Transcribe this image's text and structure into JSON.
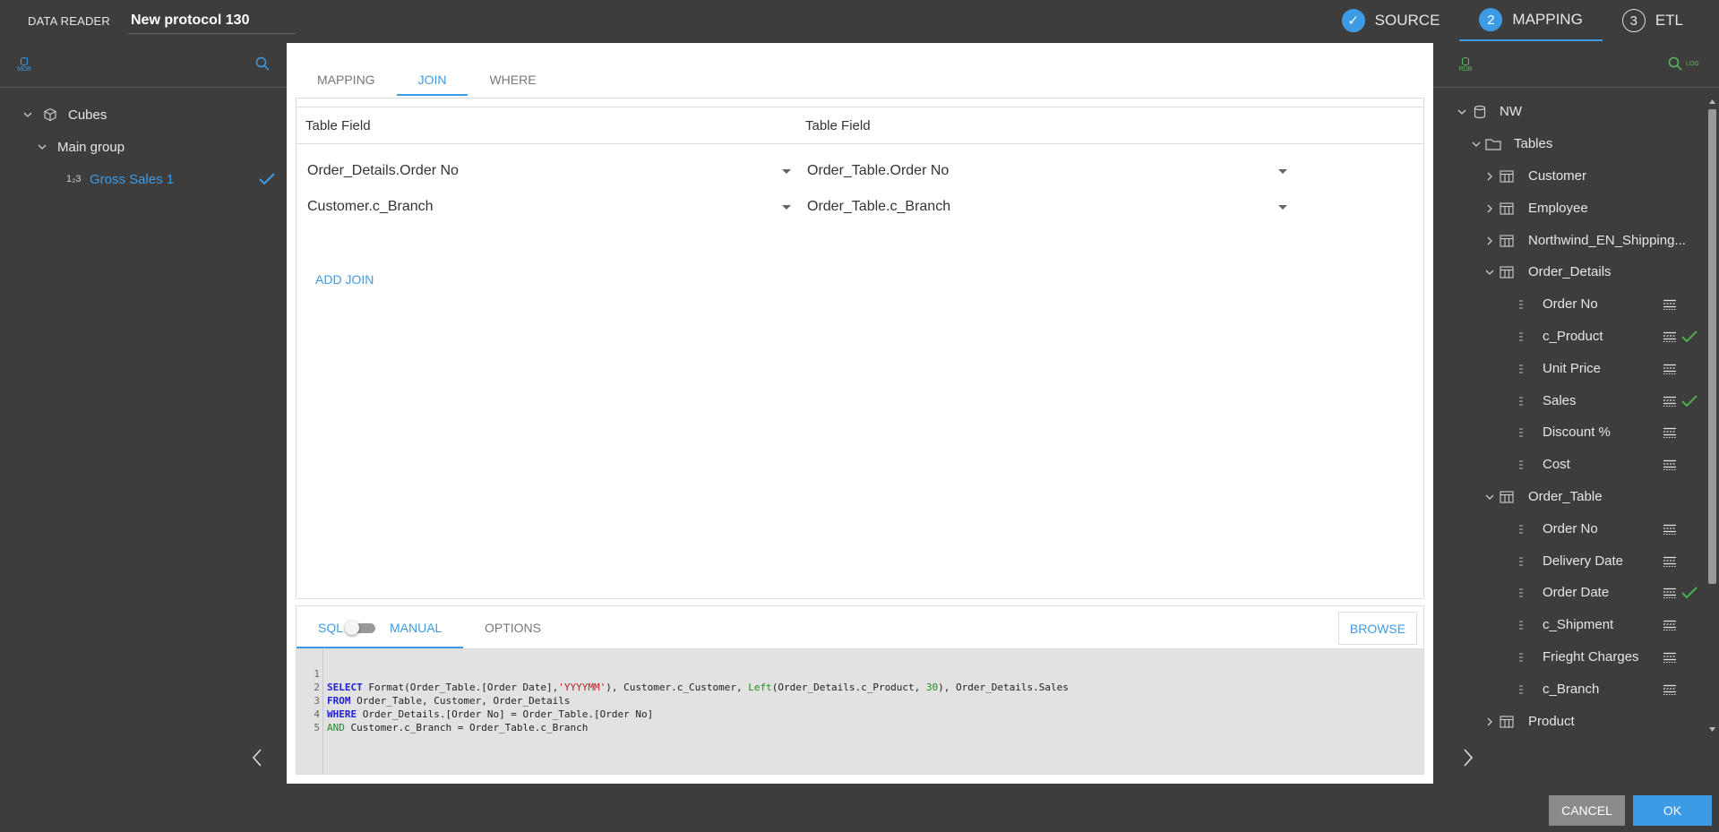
{
  "app": {
    "title": "DATA READER",
    "protocol_name": "New protocol 130"
  },
  "steps": [
    {
      "num": "✓",
      "label": "SOURCE",
      "state": "done"
    },
    {
      "num": "2",
      "label": "MAPPING",
      "state": "active"
    },
    {
      "num": "3",
      "label": "ETL",
      "state": "pending"
    }
  ],
  "left_panel": {
    "badge": "MDB",
    "tree": [
      {
        "label": "Cubes",
        "icon": "cube-icon"
      },
      {
        "label": "Main group"
      },
      {
        "label": "Gross Sales 1",
        "type_icon": "1₂3",
        "checked": true
      }
    ]
  },
  "center": {
    "tabs": [
      "MAPPING",
      "JOIN",
      "WHERE"
    ],
    "active_tab": "JOIN",
    "join_headers": [
      "Table Field",
      "Table Field"
    ],
    "joins": [
      {
        "left": "Order_Details.Order No",
        "right": "Order_Table.Order No"
      },
      {
        "left": "Customer.c_Branch",
        "right": "Order_Table.c_Branch"
      }
    ],
    "add_join_label": "ADD JOIN",
    "sql_panel": {
      "sql_label": "SQL",
      "manual_label": "MANUAL",
      "options_label": "OPTIONS",
      "browse_label": "BROWSE",
      "line_numbers": [
        "1",
        "2",
        "3",
        "4",
        "5"
      ],
      "lines": [
        "SELECT Format(Order_Table.[Order Date],'YYYYMM'), Customer.c_Customer, Left(Order_Details.c_Product, 30), Order_Details.Sales",
        "FROM Order_Table, Customer, Order_Details",
        "WHERE Order_Details.[Order No] = Order_Table.[Order No]",
        "AND Customer.c_Branch = Order_Table.c_Branch",
        ""
      ]
    }
  },
  "right_panel": {
    "badge": "RDB",
    "log_label": "LOG",
    "tree": {
      "db": "NW",
      "tables_label": "Tables",
      "tables": [
        {
          "name": "Customer",
          "expanded": false
        },
        {
          "name": "Employee",
          "expanded": false
        },
        {
          "name": "Northwind_EN_Shipping...",
          "expanded": false
        },
        {
          "name": "Order_Details",
          "expanded": true,
          "fields": [
            {
              "name": "Order No",
              "mapped": false
            },
            {
              "name": "c_Product",
              "mapped": true
            },
            {
              "name": "Unit Price",
              "mapped": false
            },
            {
              "name": "Sales",
              "mapped": true
            },
            {
              "name": "Discount %",
              "mapped": false
            },
            {
              "name": "Cost",
              "mapped": false
            }
          ]
        },
        {
          "name": "Order_Table",
          "expanded": true,
          "fields": [
            {
              "name": "Order No",
              "mapped": false
            },
            {
              "name": "Delivery Date",
              "mapped": false
            },
            {
              "name": "Order Date",
              "mapped": true
            },
            {
              "name": "c_Shipment",
              "mapped": false
            },
            {
              "name": "Frieght Charges",
              "mapped": false
            },
            {
              "name": "c_Branch",
              "mapped": false
            }
          ]
        },
        {
          "name": "Product",
          "expanded": false
        }
      ]
    }
  },
  "footer": {
    "cancel_label": "CANCEL",
    "ok_label": "OK"
  },
  "colors": {
    "accent": "#3d9be6",
    "background": "#3d3d3d",
    "check_green": "#4caf50",
    "log_green": "#5cb85c"
  }
}
